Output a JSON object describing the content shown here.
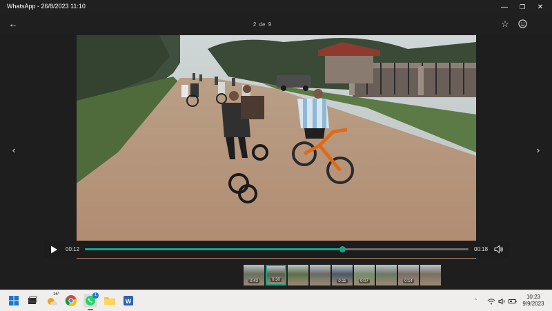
{
  "window": {
    "title": "WhatsApp - 26/8/2023 11:10",
    "minimize_icon": "minimize-icon",
    "maximize_icon": "restore-icon",
    "close_icon": "close-icon"
  },
  "viewer": {
    "position_index": "2",
    "position_sep": "de",
    "position_total": "9",
    "back_icon": "arrow-left-icon",
    "star_icon": "star-icon",
    "emoji_icon": "emoji-icon",
    "prev_icon": "chevron-left-icon",
    "next_icon": "chevron-right-icon"
  },
  "player": {
    "elapsed": "00:12",
    "duration": "00:18",
    "progress": 0.67,
    "play_icon": "play-icon",
    "volume_icon": "volume-icon",
    "progress_color": "#13a88c"
  },
  "filmstrip": [
    {
      "duration": "0:43",
      "selected": false
    },
    {
      "duration": "0:30",
      "selected": true
    },
    {
      "duration": "",
      "selected": false
    },
    {
      "duration": "",
      "selected": false
    },
    {
      "duration": "0:11",
      "selected": false
    },
    {
      "duration": "0:07",
      "selected": false
    },
    {
      "duration": "",
      "selected": false
    },
    {
      "duration": "0:14",
      "selected": false
    },
    {
      "duration": "",
      "selected": false
    }
  ],
  "taskbar": {
    "weather_temp": "16°",
    "whatsapp_badge": "1",
    "time": "10:23",
    "date": "9/9/2023"
  }
}
